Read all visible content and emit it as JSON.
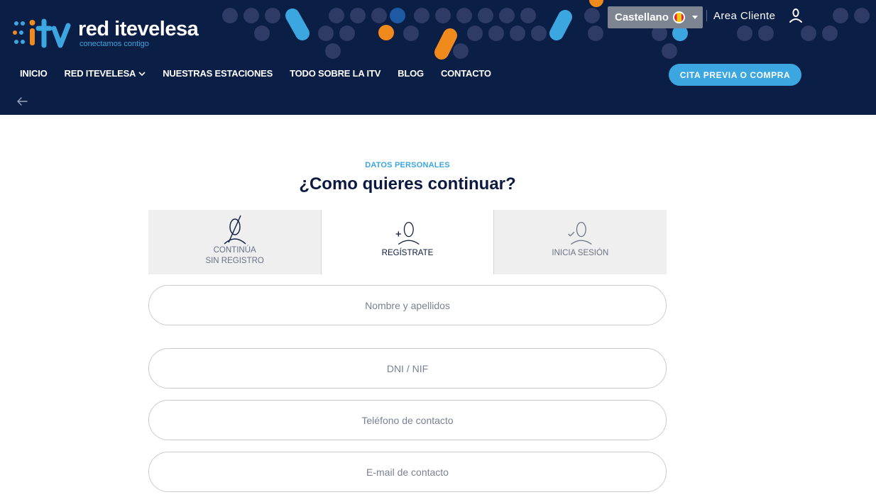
{
  "brand": {
    "name": "red itevelesa",
    "tagline": "conectamos contigo"
  },
  "header": {
    "language": {
      "selected": "Castellano",
      "flag": "spain-flag-icon"
    },
    "client_area": "Area Cliente",
    "cta_label": "CITA PREVIA O COMPRA",
    "nav": [
      {
        "label": "INICIO"
      },
      {
        "label": "RED ITEVELESA",
        "has_dropdown": true
      },
      {
        "label": "NUESTRAS ESTACIONES"
      },
      {
        "label": "TODO SOBRE LA ITV"
      },
      {
        "label": "BLOG"
      },
      {
        "label": "CONTACTO"
      }
    ]
  },
  "main": {
    "eyebrow": "DATOS PERSONALES",
    "title": "¿Como quieres continuar?",
    "options": [
      {
        "line1": "CONTINÚA",
        "line2": "SIN REGISTRO",
        "icon": "no-user-icon",
        "active": false
      },
      {
        "line1": "REGÍSTRATE",
        "line2": "",
        "icon": "add-user-icon",
        "active": true
      },
      {
        "line1": "INICIA SESIÓN",
        "line2": "",
        "icon": "login-user-icon",
        "active": false
      }
    ],
    "fields": [
      {
        "placeholder": "Nombre y apellidos",
        "value": ""
      },
      {
        "placeholder": "DNI / NIF",
        "value": ""
      },
      {
        "placeholder": "Teléfono de contacto",
        "value": ""
      },
      {
        "placeholder": "E-mail de contacto",
        "value": ""
      }
    ]
  },
  "colors": {
    "navy": "#0b1e46",
    "accent_blue": "#3ba6e0",
    "accent_orange": "#f18a1c",
    "dot": "#2e3b66"
  }
}
